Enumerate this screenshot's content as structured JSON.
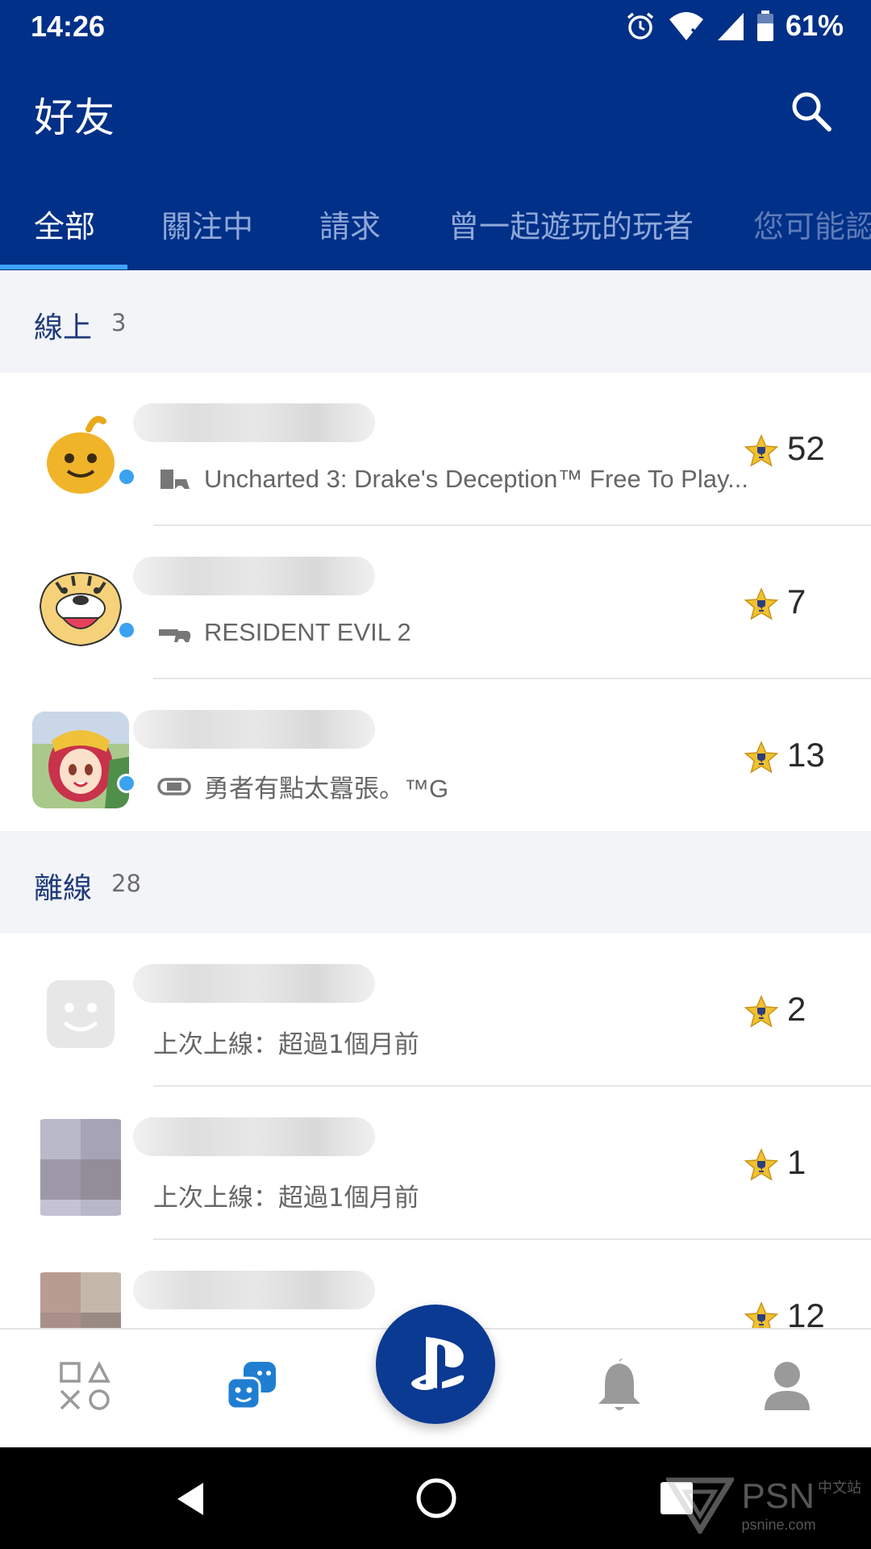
{
  "status_bar": {
    "time": "14:26",
    "battery": "61%"
  },
  "app_bar": {
    "title": "好友"
  },
  "tabs": [
    {
      "label": "全部"
    },
    {
      "label": "關注中"
    },
    {
      "label": "請求"
    },
    {
      "label": "曾一起遊玩的玩者"
    },
    {
      "label": "您可能認"
    }
  ],
  "online": {
    "label": "線上",
    "count": "3",
    "friends": [
      {
        "game": "Uncharted 3: Drake's Deception™ Free To Play...",
        "platform_icon": "ps3-console-icon",
        "trophy_level": "52"
      },
      {
        "game": "RESIDENT EVIL 2",
        "platform_icon": "ps4-console-icon",
        "trophy_level": "7"
      },
      {
        "game": "勇者有點太囂張。™G",
        "platform_icon": "vita-console-icon",
        "trophy_level": "13"
      }
    ]
  },
  "offline": {
    "label": "離線",
    "count": "28",
    "friends": [
      {
        "last_seen": "上次上線：超過1個月前",
        "trophy_level": "2"
      },
      {
        "last_seen": "上次上線：超過1個月前",
        "trophy_level": "1"
      },
      {
        "trophy_level": "12"
      }
    ]
  },
  "bottom_nav": [
    {
      "icon": "playstation-shapes-icon"
    },
    {
      "icon": "friends-icon"
    },
    {
      "icon": "playstation-logo-icon"
    },
    {
      "icon": "notifications-bell-icon"
    },
    {
      "icon": "profile-icon"
    }
  ],
  "watermark": {
    "text": "PSN",
    "subtext": "psnine.com",
    "tag": "中文站"
  },
  "colors": {
    "brand_blue": "#003087",
    "accent": "#41a3ff",
    "online_dot": "#3aa2ee",
    "trophy_gold": "#f2c12e"
  }
}
